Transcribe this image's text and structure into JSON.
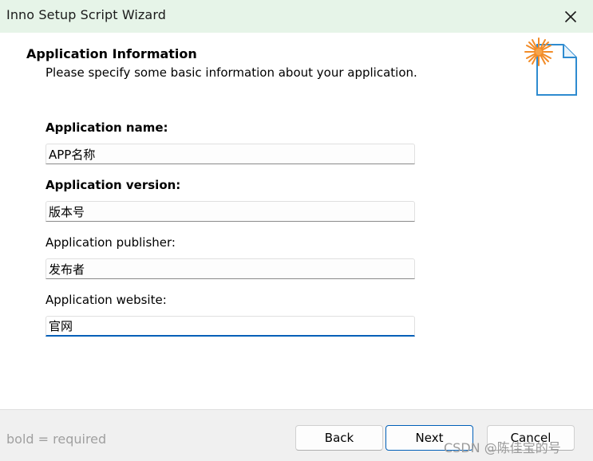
{
  "window": {
    "title": "Inno Setup Script Wizard",
    "close_icon": "close-icon"
  },
  "header": {
    "title": "Application Information",
    "subtitle": "Please specify some basic information about your application.",
    "icon": "wizard-document-icon"
  },
  "form": {
    "fields": [
      {
        "label": "Application name:",
        "value": "APP名称",
        "required": true
      },
      {
        "label": "Application version:",
        "value": "版本号",
        "required": true
      },
      {
        "label": "Application publisher:",
        "value": "发布者",
        "required": false
      },
      {
        "label": "Application website:",
        "value": "官网",
        "required": false,
        "focused": true
      }
    ]
  },
  "footer": {
    "hint": "bold = required",
    "back_label": "Back",
    "next_label": "Next",
    "cancel_label": "Cancel"
  },
  "watermark": "CSDN @陈佳宝的号",
  "colors": {
    "titlebar_bg": "#e6f4e8",
    "accent": "#005fb8",
    "footer_bg": "#f0f0f0",
    "icon_spark": "#f28c28",
    "icon_outline": "#2e8bd0"
  }
}
